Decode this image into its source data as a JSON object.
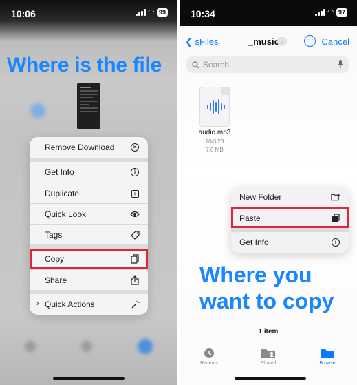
{
  "left": {
    "status_time": "10:06",
    "battery": "99",
    "headline": "Where is the file",
    "menu_items": [
      {
        "label": "Remove Download",
        "icon": "remove-circle-icon"
      },
      {
        "label": "Get Info",
        "icon": "info-icon"
      },
      {
        "label": "Duplicate",
        "icon": "duplicate-icon"
      },
      {
        "label": "Quick Look",
        "icon": "eye-icon"
      },
      {
        "label": "Tags",
        "icon": "tag-icon"
      },
      {
        "label": "Copy",
        "icon": "copy-icon",
        "highlighted": true
      },
      {
        "label": "Share",
        "icon": "share-icon"
      },
      {
        "label": "Quick Actions",
        "icon": "magic-wand-icon"
      }
    ]
  },
  "right": {
    "status_time": "10:34",
    "battery": "97",
    "back_label": "sFiles",
    "title": "_music",
    "cancel_label": "Cancel",
    "search_placeholder": "Search",
    "file": {
      "name": "audio.mp3",
      "date": "10/3/23",
      "size": "7.6 MB"
    },
    "menu_items": [
      {
        "label": "New Folder",
        "icon": "new-folder-icon"
      },
      {
        "label": "Paste",
        "icon": "paste-icon",
        "highlighted": true
      },
      {
        "label": "Get Info",
        "icon": "info-icon"
      }
    ],
    "headline_line1": "Where you",
    "headline_line2": "want to copy",
    "item_count": "1 item",
    "tabs": [
      {
        "label": "Recents",
        "icon": "clock-icon"
      },
      {
        "label": "Shared",
        "icon": "shared-folder-icon"
      },
      {
        "label": "Browse",
        "icon": "folder-icon",
        "active": true
      }
    ]
  },
  "colors": {
    "accent": "#0a7aff",
    "headline": "#1a86ff",
    "highlight": "#e0263a"
  }
}
